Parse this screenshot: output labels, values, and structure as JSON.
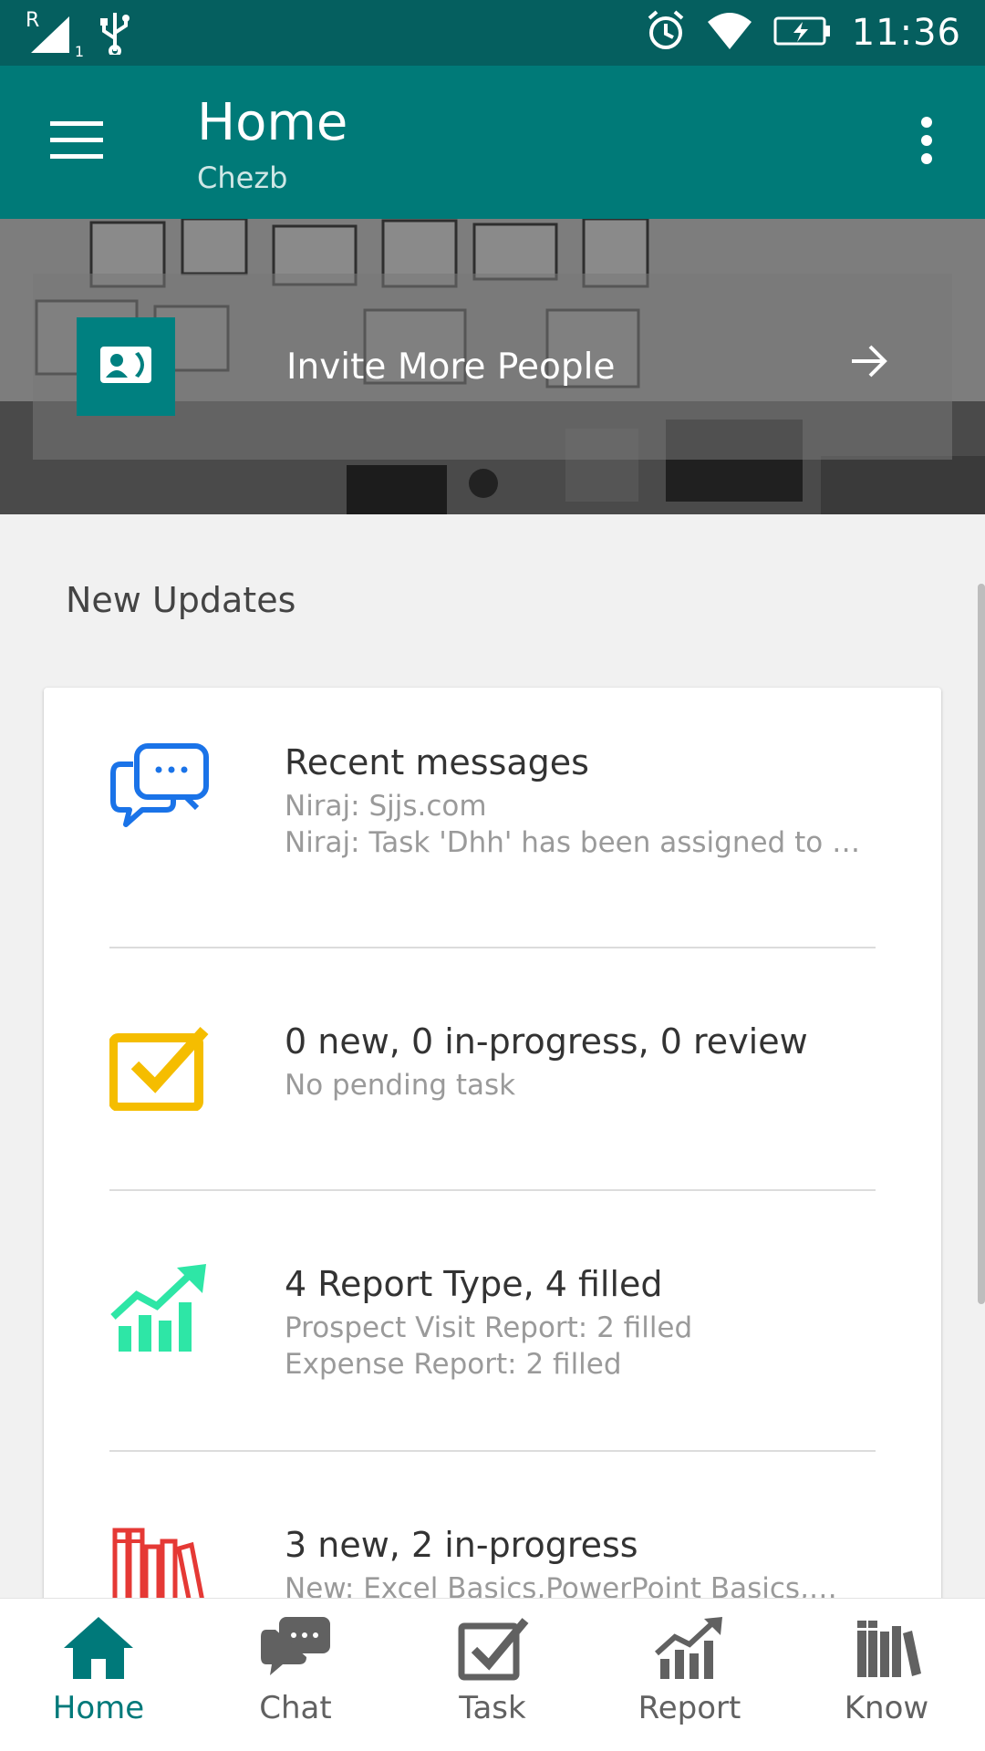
{
  "status_bar": {
    "signal_indicator": "R",
    "signal_sub": "1",
    "time": "11:36",
    "icons": [
      "signal-icon",
      "usb-icon",
      "alarm-icon",
      "wifi-icon",
      "battery-charging-icon"
    ]
  },
  "app_bar": {
    "title": "Home",
    "subtitle": "Chezb",
    "icons": [
      "menu-icon",
      "more-vert-icon"
    ]
  },
  "banner": {
    "invite_label": "Invite More People",
    "icons": [
      "contact-card-icon",
      "arrow-right-icon"
    ]
  },
  "section_title": "New Updates",
  "updates": [
    {
      "icon": "chat-bubbles-icon",
      "icon_color": "#1a73e8",
      "heading": "Recent messages",
      "lines": [
        "Niraj: Sjjs.com",
        "Niraj: Task 'Dhh' has been assigned to …"
      ]
    },
    {
      "icon": "task-checkbox-icon",
      "icon_color": "#f5bd00",
      "heading": "0 new, 0 in-progress, 0 review",
      "lines": [
        "No pending task"
      ]
    },
    {
      "icon": "report-chart-icon",
      "icon_color": "#2ee6a6",
      "heading": "4 Report Type, 4 filled",
      "lines": [
        "Prospect Visit Report: 2 filled",
        "Expense Report: 2 filled"
      ]
    },
    {
      "icon": "books-icon",
      "icon_color": "#e53935",
      "heading": "3 new, 2 in-progress",
      "lines": [
        "New: Excel Basics,PowerPoint Basics,…"
      ]
    }
  ],
  "bottom_nav": [
    {
      "label": "Home",
      "icon": "home-icon",
      "active": true
    },
    {
      "label": "Chat",
      "icon": "chat-icon",
      "active": false
    },
    {
      "label": "Task",
      "icon": "task-icon",
      "active": false
    },
    {
      "label": "Report",
      "icon": "report-icon",
      "active": false
    },
    {
      "label": "Know",
      "icon": "knowledge-books-icon",
      "active": false
    }
  ],
  "colors": {
    "status_bar": "#055f5f",
    "app_bar": "#007a78",
    "accent": "#00797a",
    "nav_inactive": "#616161"
  }
}
